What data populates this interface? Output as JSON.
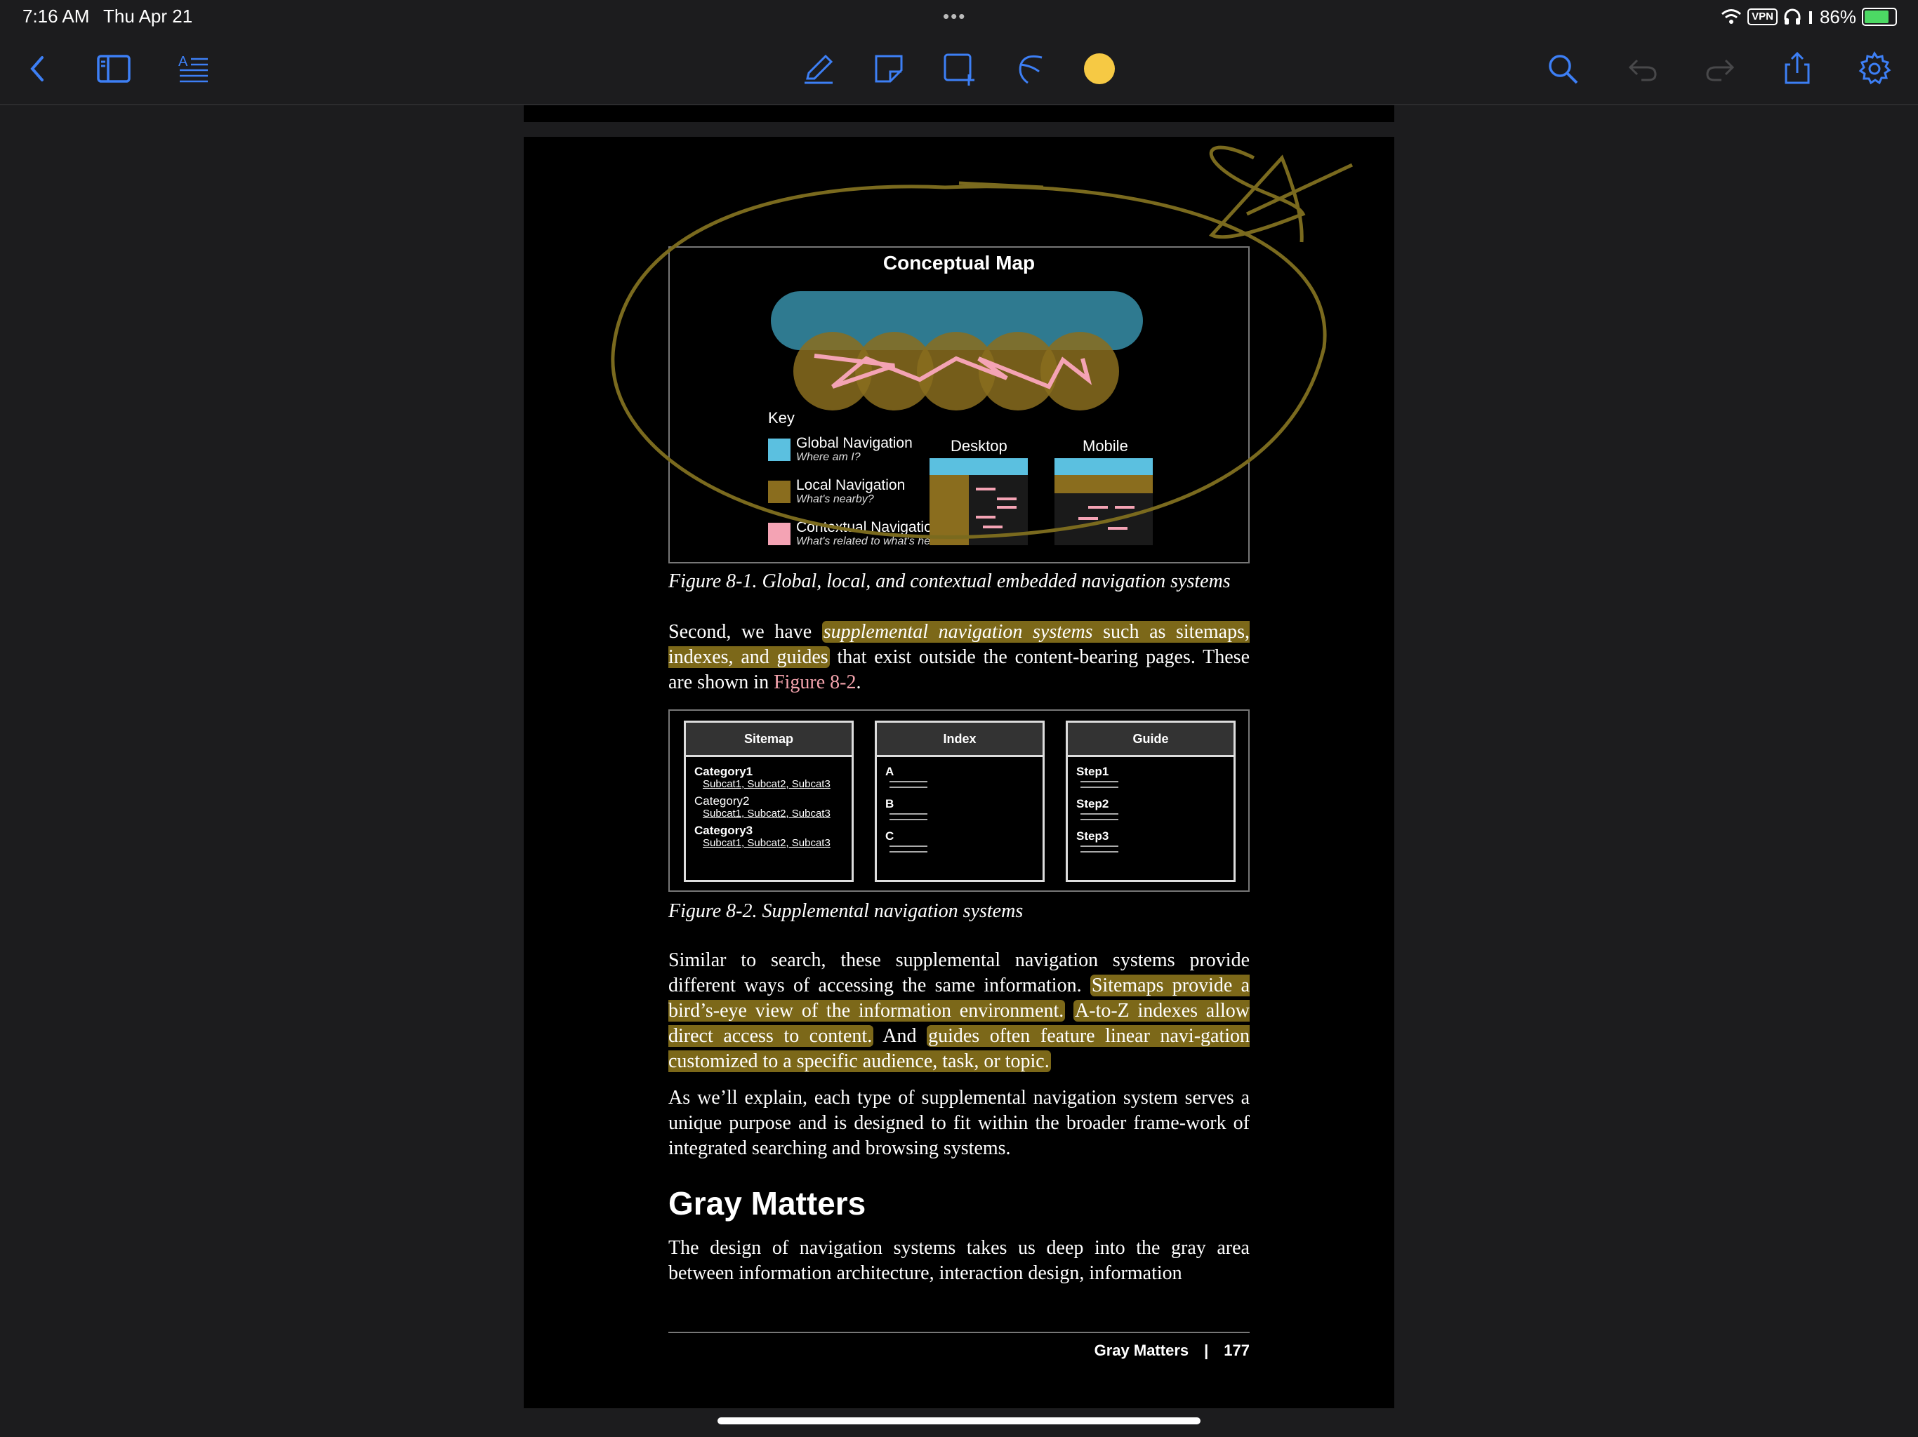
{
  "status_bar": {
    "time": "7:16 AM",
    "date": "Thu Apr 21",
    "dots": "•••",
    "vpn": "VPN",
    "battery": "86%"
  },
  "toolbar": {
    "left_icons": [
      "back-chevron-icon",
      "sidebar-icon",
      "text-outline-icon"
    ],
    "center_icons": [
      "pen-icon",
      "shape-icon",
      "add-page-icon",
      "lasso-icon"
    ],
    "color": "#f6c944",
    "right_icons": [
      "search-icon",
      "undo-icon",
      "redo-icon",
      "share-icon",
      "gear-icon"
    ]
  },
  "figure1": {
    "title": "Conceptual Map",
    "key_title": "Key",
    "key": [
      {
        "label": "Global Navigation",
        "sub": "Where am I?",
        "color": "#5bc0e0"
      },
      {
        "label": "Local Navigation",
        "sub": "What's nearby?",
        "color": "#8a6d1e"
      },
      {
        "label": "Contextual Navigation",
        "sub": "What's related to what's here?",
        "color": "#f4a3b4"
      }
    ],
    "desktop_label": "Desktop",
    "mobile_label": "Mobile",
    "caption": "Figure 8-1. Global, local, and contextual embedded navigation systems"
  },
  "para1": {
    "t1": "Second, we have ",
    "h1": "supplemental navigation systems",
    "h2": " such as sitemaps, indexes, and guides",
    "t2": " that exist outside the content-bearing pages. These are shown in ",
    "link": "Figure 8-2",
    "t3": "."
  },
  "figure2": {
    "sitemap": {
      "title": "Sitemap",
      "items": [
        {
          "name": "Category1",
          "subs": "Subcat1, Subcat2, Subcat3"
        },
        {
          "name": "Category2",
          "subs": "Subcat1, Subcat2, Subcat3"
        },
        {
          "name": "Category3",
          "subs": "Subcat1, Subcat2, Subcat3"
        }
      ]
    },
    "index": {
      "title": "Index",
      "letters": [
        "A",
        "B",
        "C"
      ]
    },
    "guide": {
      "title": "Guide",
      "steps": [
        "Step1",
        "Step2",
        "Step3"
      ]
    },
    "caption": "Figure 8-2. Supplemental navigation systems"
  },
  "para2": {
    "t1": "Similar to search, these supplemental navigation systems provide different ways of accessing the same information. ",
    "h1": "Sitemaps provide a bird’s-eye view of the information environment.",
    "t2": " ",
    "h2": "A-to-Z indexes allow direct access to content.",
    "t3": " And ",
    "h3": "guides often feature linear navi-gation customized to a specific audience, task, or topic."
  },
  "para3": "As we’ll explain, each type of supplemental navigation system serves a unique purpose and is designed to fit within the broader frame-work of integrated searching and browsing systems.",
  "heading": "Gray Matters",
  "para4": "The design of navigation systems takes us deep into the gray area between information architecture, interaction design, information",
  "footer": {
    "section": "Gray Matters",
    "separator": "|",
    "page": "177"
  },
  "annotation_color": "#7a6a1e"
}
